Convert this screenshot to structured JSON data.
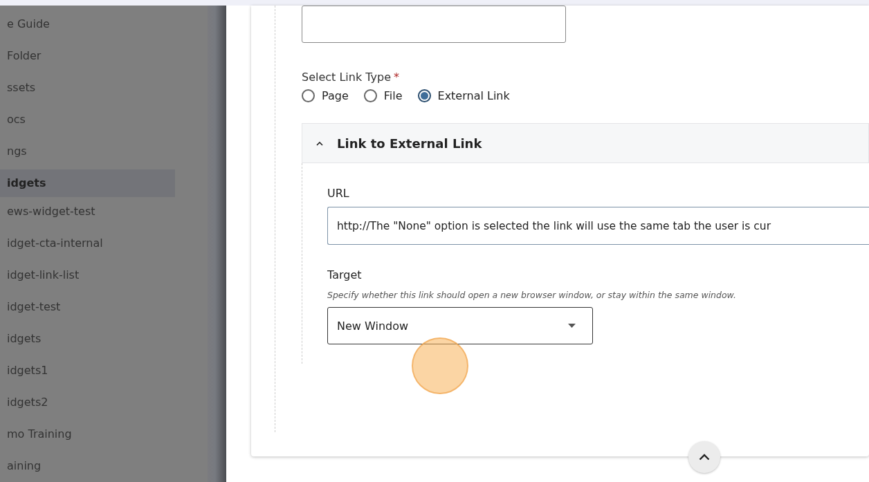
{
  "sidebar": {
    "items": [
      {
        "label": "e Guide",
        "selected": false
      },
      {
        "label": "Folder",
        "selected": false
      },
      {
        "label": "ssets",
        "selected": false
      },
      {
        "label": "ocs",
        "selected": false
      },
      {
        "label": "ngs",
        "selected": false
      },
      {
        "label": "idgets",
        "selected": true
      },
      {
        "label": "ews-widget-test",
        "selected": false
      },
      {
        "label": "idget-cta-internal",
        "selected": false
      },
      {
        "label": "idget-link-list",
        "selected": false
      },
      {
        "label": "idget-test",
        "selected": false
      },
      {
        "label": "idgets",
        "selected": false
      },
      {
        "label": "idgets1",
        "selected": false
      },
      {
        "label": "idgets2",
        "selected": false
      },
      {
        "label": "mo Training",
        "selected": false
      },
      {
        "label": "aining",
        "selected": false
      }
    ]
  },
  "form": {
    "link_type": {
      "label": "Select Link Type",
      "required_mark": "*",
      "options": [
        {
          "label": "Page",
          "selected": false
        },
        {
          "label": "File",
          "selected": false
        },
        {
          "label": "External Link",
          "selected": true
        }
      ]
    },
    "section": {
      "title": "Link to External Link",
      "expanded": true,
      "url": {
        "label": "URL",
        "value": "http://The \"None\" option is selected the link will use the same tab the user is cur"
      },
      "target": {
        "label": "Target",
        "help": "Specify whether this link should open a new browser window, or stay within the same window.",
        "value": "New Window"
      }
    }
  }
}
